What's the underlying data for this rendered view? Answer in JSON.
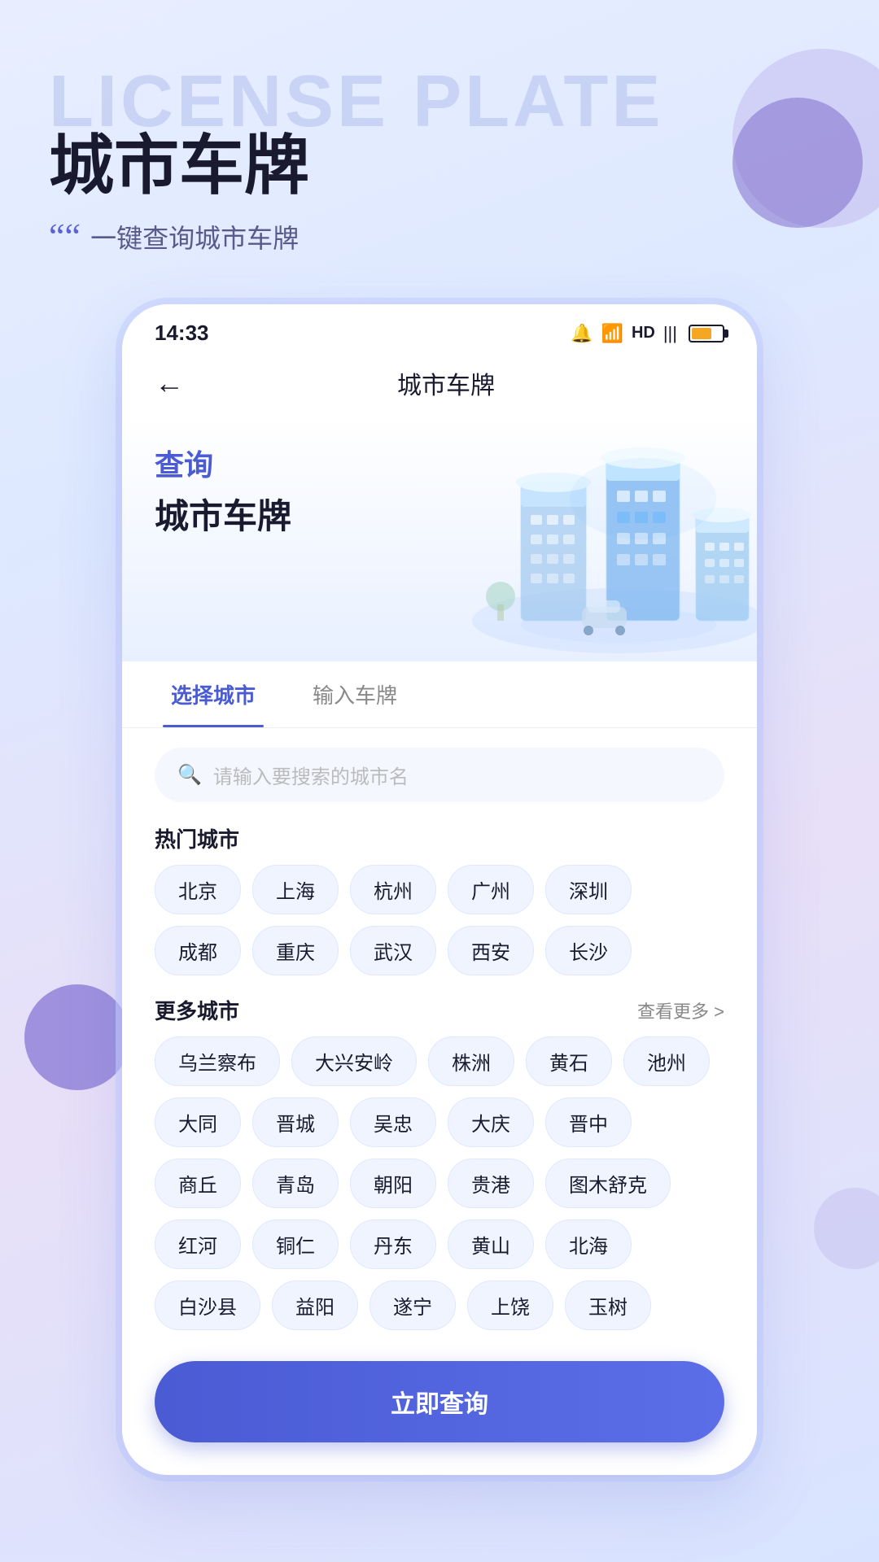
{
  "background": {
    "bg_text": "LICENSE PLATE"
  },
  "header": {
    "title": "城市车牌",
    "subtitle": "一键查询城市车牌",
    "quote": "““"
  },
  "status_bar": {
    "time": "14:33",
    "icons_label": "status icons"
  },
  "nav": {
    "back_label": "←",
    "title": "城市车牌"
  },
  "hero": {
    "label": "查询",
    "title": "城市车牌"
  },
  "tabs": [
    {
      "id": "select-city",
      "label": "选择城市",
      "active": true
    },
    {
      "id": "enter-plate",
      "label": "输入车牌",
      "active": false
    }
  ],
  "search": {
    "placeholder": "请输入要搜索的城市名"
  },
  "hot_cities": {
    "section_title": "热门城市",
    "cities": [
      "北京",
      "上海",
      "杭州",
      "广州",
      "深圳",
      "成都",
      "重庆",
      "武汉",
      "西安",
      "长沙"
    ]
  },
  "more_cities": {
    "section_title": "更多城市",
    "more_link": "查看更多 >",
    "cities": [
      "乌兰察布",
      "大兴安岭",
      "株洲",
      "黄石",
      "池州",
      "大同",
      "晋城",
      "吴忠",
      "大庆",
      "晋中",
      "商丘",
      "青岛",
      "朝阳",
      "贵港",
      "图木舒克",
      "红河",
      "铜仁",
      "丹东",
      "黄山",
      "北海",
      "白沙县",
      "益阳",
      "遂宁",
      "上饶",
      "玉树"
    ]
  },
  "cta": {
    "label": "立即查询"
  }
}
